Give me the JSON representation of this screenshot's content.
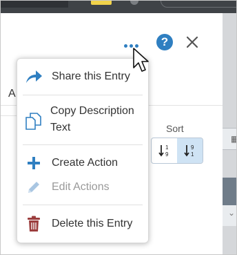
{
  "menu": {
    "items": [
      {
        "label": "Share this Entry",
        "icon": "share-icon"
      },
      {
        "label": "Copy Description Text",
        "label_line1": "Copy Description",
        "label_line2": "Text",
        "icon": "copy-icon"
      },
      {
        "label": "Create Action",
        "icon": "plus-icon"
      },
      {
        "label": "Edit Actions",
        "icon": "pencil-icon",
        "disabled": true
      },
      {
        "label": "Delete this Entry",
        "icon": "trash-icon"
      }
    ]
  },
  "header": {
    "help_label": "?",
    "close_label": "✕",
    "more_icon": "ellipsis-icon"
  },
  "background": {
    "partial_letter": "A",
    "sort_label": "Sort"
  },
  "colors": {
    "accent": "#2f7fc1",
    "danger": "#9b3d3d",
    "disabled": "#a9c6e2",
    "sort_active": "#cfe3f4"
  }
}
